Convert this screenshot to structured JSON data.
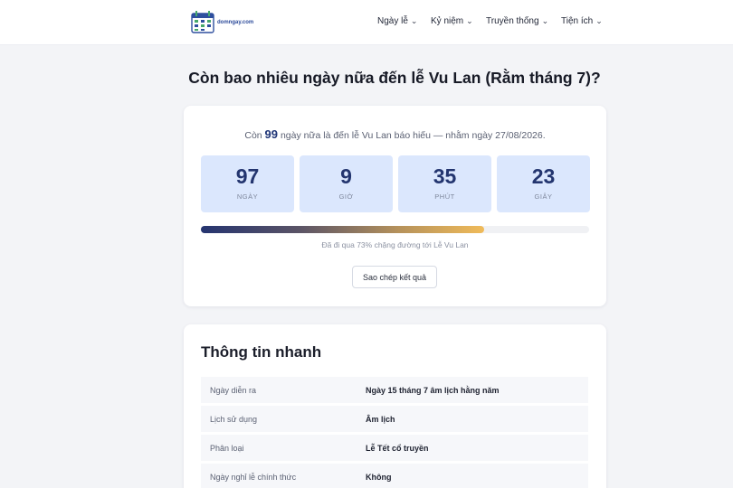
{
  "header": {
    "logo_text": "domngay.com",
    "nav": [
      {
        "label": "Ngày lễ"
      },
      {
        "label": "Kỷ niệm"
      },
      {
        "label": "Truyền thống"
      },
      {
        "label": "Tiện ích"
      }
    ]
  },
  "page_title": "Còn bao nhiêu ngày nữa đến lễ Vu Lan (Rằm tháng 7)?",
  "countdown": {
    "lead_prefix": "Còn",
    "days_remaining": "99",
    "lead_suffix": "ngày nữa là đến lễ Vu Lan báo hiếu — nhằm ngày 27/08/2026.",
    "units": [
      {
        "value": "97",
        "label": "NGÀY"
      },
      {
        "value": "9",
        "label": "GIỜ"
      },
      {
        "value": "35",
        "label": "PHÚT"
      },
      {
        "value": "23",
        "label": "GIÂY"
      }
    ],
    "progress_percent": 73,
    "progress_caption": "Đã đi qua 73% chặng đường tới Lễ Vu Lan",
    "copy_button_label": "Sao chép kết quả"
  },
  "quick_info": {
    "title": "Thông tin nhanh",
    "rows": [
      {
        "key": "Ngày diễn ra",
        "value": "Ngày 15 tháng 7 âm lịch hằng năm"
      },
      {
        "key": "Lịch sử dụng",
        "value": "Âm lịch"
      },
      {
        "key": "Phân loại",
        "value": "Lễ Tết cổ truyền"
      },
      {
        "key": "Ngày nghỉ lễ chính thức",
        "value": "Không"
      }
    ]
  },
  "colors": {
    "accent_dark": "#23356f",
    "box_bg": "#dbe7fd",
    "progress_end": "#f0bb5a"
  }
}
